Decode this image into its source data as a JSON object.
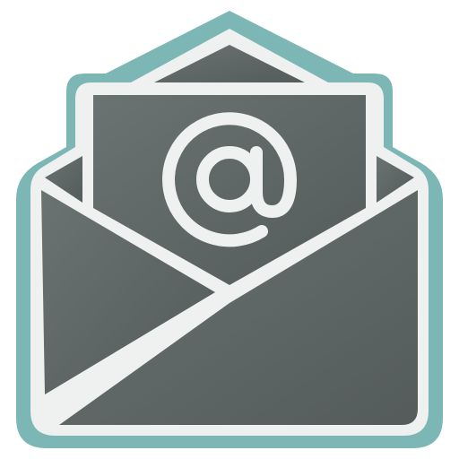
{
  "icon": {
    "name": "open-envelope-email-icon",
    "symbol": "@",
    "colors": {
      "outline": "#7db7b5",
      "stroke": "#eef1ef",
      "fill_top": "#6a7372",
      "fill_bottom": "#545b5b"
    }
  }
}
